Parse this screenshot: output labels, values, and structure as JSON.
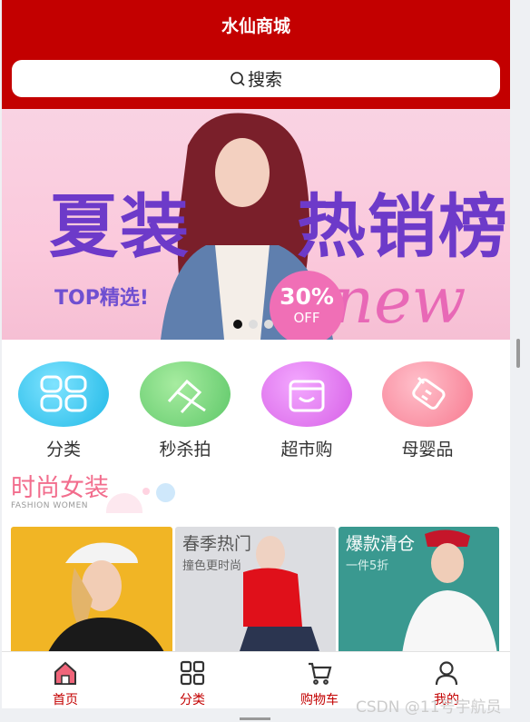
{
  "header": {
    "title": "水仙商城",
    "search_label": "搜索"
  },
  "banner": {
    "headline_left": "夏装",
    "headline_right": "热销榜",
    "top_text": "TOP精选!",
    "badge_percent": "30%",
    "badge_off": "OFF",
    "script_text": "new",
    "slides": 3,
    "active_slide": 1
  },
  "categories": [
    {
      "label": "分类",
      "icon": "grid-icon",
      "color": "#27c6ea"
    },
    {
      "label": "秒杀拍",
      "icon": "hammer-icon",
      "color": "#6fd27a"
    },
    {
      "label": "超市购",
      "icon": "store-icon",
      "color": "#e67aee"
    },
    {
      "label": "母婴品",
      "icon": "baby-bottle-icon",
      "color": "#fb8ca0"
    }
  ],
  "section": {
    "title": "时尚女装",
    "subtitle": "FASHION WOMEN"
  },
  "products": [
    {
      "title": "",
      "subtitle": "",
      "color": "#f1b525"
    },
    {
      "title": "春季热门",
      "subtitle": "撞色更时尚",
      "color": "#dcdde1"
    },
    {
      "title": "爆款清仓",
      "subtitle": "一件5折",
      "color": "#3a9990"
    }
  ],
  "tabbar": [
    {
      "label": "首页",
      "icon": "home-icon"
    },
    {
      "label": "分类",
      "icon": "grid-icon"
    },
    {
      "label": "购物车",
      "icon": "cart-icon"
    },
    {
      "label": "我的",
      "icon": "user-icon"
    }
  ],
  "watermark": "CSDN @11号宇航员",
  "colors": {
    "brand": "#c30000",
    "banner_purple": "#6d3ac9",
    "section_pink": "#f26d8d"
  }
}
